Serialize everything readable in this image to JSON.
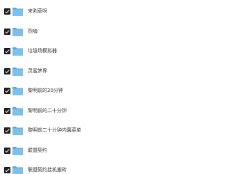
{
  "items": [
    {
      "label": "来割草呀",
      "checked": true,
      "icon": "folder-icon"
    },
    {
      "label": "烈嗨",
      "checked": true,
      "icon": "folder-icon"
    },
    {
      "label": "垃圾场模拟器",
      "checked": true,
      "icon": "folder-icon"
    },
    {
      "label": "灵蜜梦界",
      "checked": true,
      "icon": "folder-icon"
    },
    {
      "label": "黎明前的20分钟",
      "checked": true,
      "icon": "folder-icon"
    },
    {
      "label": "黎明前的二十分钟",
      "checked": true,
      "icon": "folder-icon"
    },
    {
      "label": "黎明前二十分钟内置菜单",
      "checked": true,
      "icon": "folder-icon"
    },
    {
      "label": "联盟契约",
      "checked": true,
      "icon": "folder-icon"
    },
    {
      "label": "联盟契约挂机搬砖",
      "checked": true,
      "icon": "folder-icon"
    }
  ],
  "colors": {
    "folder_front": "#7cc0ec",
    "folder_back": "#5aa6dc",
    "checkbox": "#222222"
  }
}
